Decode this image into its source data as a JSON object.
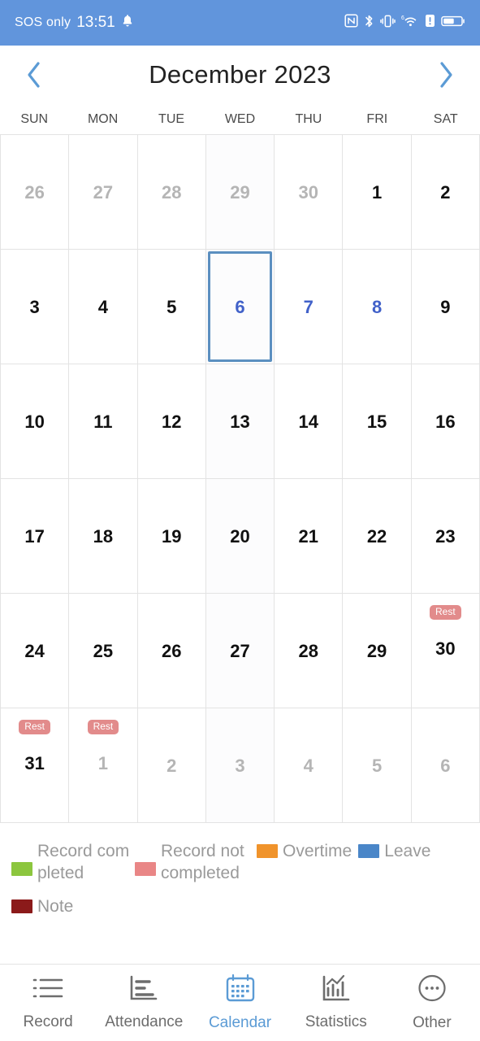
{
  "statusbar": {
    "carrier": "SOS only",
    "time": "13:51",
    "bell_icon": "bell-icon",
    "icons": [
      "nfc-icon",
      "bluetooth-icon",
      "vibrate-icon",
      "wifi-icon",
      "alert-icon",
      "battery-icon"
    ],
    "background": "#6195DC"
  },
  "header": {
    "prev_icon": "chevron-left-icon",
    "next_icon": "chevron-right-icon",
    "title": "December 2023",
    "accent": "#5B9BD5"
  },
  "weekdays": [
    "SUN",
    "MON",
    "TUE",
    "WED",
    "THU",
    "FRI",
    "SAT"
  ],
  "calendar": {
    "badge_label": "Rest",
    "badge_color": "#E28B8B",
    "selected_border": "#5B8FC0",
    "accent_day_color": "#4161C9",
    "weeks": [
      [
        {
          "day": "26",
          "muted": true
        },
        {
          "day": "27",
          "muted": true
        },
        {
          "day": "28",
          "muted": true
        },
        {
          "day": "29",
          "muted": true
        },
        {
          "day": "30",
          "muted": true
        },
        {
          "day": "1",
          "muted": false
        },
        {
          "day": "2",
          "muted": false
        }
      ],
      [
        {
          "day": "3",
          "muted": false
        },
        {
          "day": "4",
          "muted": false
        },
        {
          "day": "5",
          "muted": false
        },
        {
          "day": "6",
          "muted": false,
          "accent": true,
          "selected": true
        },
        {
          "day": "7",
          "muted": false,
          "accent": true
        },
        {
          "day": "8",
          "muted": false,
          "accent": true
        },
        {
          "day": "9",
          "muted": false
        }
      ],
      [
        {
          "day": "10",
          "muted": false
        },
        {
          "day": "11",
          "muted": false
        },
        {
          "day": "12",
          "muted": false
        },
        {
          "day": "13",
          "muted": false
        },
        {
          "day": "14",
          "muted": false
        },
        {
          "day": "15",
          "muted": false
        },
        {
          "day": "16",
          "muted": false
        }
      ],
      [
        {
          "day": "17",
          "muted": false
        },
        {
          "day": "18",
          "muted": false
        },
        {
          "day": "19",
          "muted": false
        },
        {
          "day": "20",
          "muted": false
        },
        {
          "day": "21",
          "muted": false
        },
        {
          "day": "22",
          "muted": false
        },
        {
          "day": "23",
          "muted": false
        }
      ],
      [
        {
          "day": "24",
          "muted": false
        },
        {
          "day": "25",
          "muted": false
        },
        {
          "day": "26",
          "muted": false
        },
        {
          "day": "27",
          "muted": false
        },
        {
          "day": "28",
          "muted": false
        },
        {
          "day": "29",
          "muted": false
        },
        {
          "day": "30",
          "muted": false,
          "badge": "Rest"
        }
      ],
      [
        {
          "day": "31",
          "muted": false,
          "badge": "Rest"
        },
        {
          "day": "1",
          "muted": true,
          "badge": "Rest"
        },
        {
          "day": "2",
          "muted": true
        },
        {
          "day": "3",
          "muted": true
        },
        {
          "day": "4",
          "muted": true
        },
        {
          "day": "5",
          "muted": true
        },
        {
          "day": "6",
          "muted": true
        }
      ]
    ]
  },
  "legend": [
    {
      "label": "Record completed",
      "color": "#8CC63E"
    },
    {
      "label": "Record not completed",
      "color": "#E98686"
    },
    {
      "label": "Overtime",
      "color": "#F0932B"
    },
    {
      "label": "Leave",
      "color": "#4A86C8"
    },
    {
      "label": "Note",
      "color": "#8B1A1A"
    }
  ],
  "bottomnav": {
    "active_color": "#5B9BD5",
    "items": [
      {
        "label": "Record",
        "icon": "list-icon",
        "active": false
      },
      {
        "label": "Attendance",
        "icon": "bar-chart-horizontal-icon",
        "active": false
      },
      {
        "label": "Calendar",
        "icon": "calendar-icon",
        "active": true
      },
      {
        "label": "Statistics",
        "icon": "chart-analytics-icon",
        "active": false
      },
      {
        "label": "Other",
        "icon": "ellipsis-circle-icon",
        "active": false
      }
    ]
  }
}
